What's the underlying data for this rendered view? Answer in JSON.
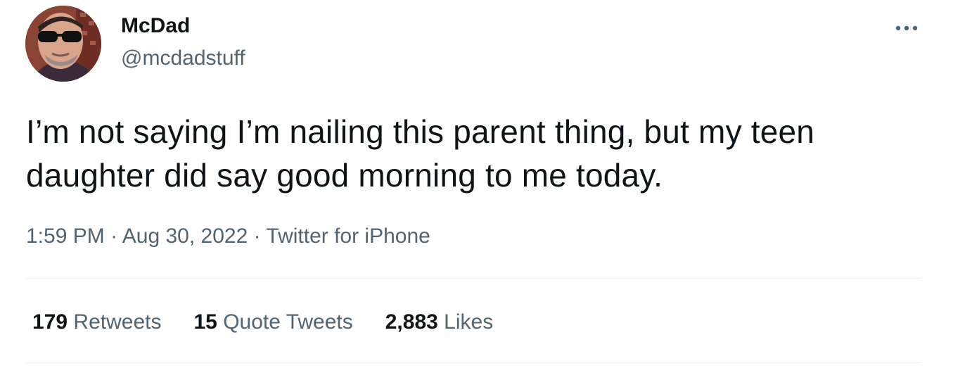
{
  "author": {
    "display_name": "McDad",
    "handle": "@mcdadstuff"
  },
  "tweet": {
    "text": "I’m not saying I’m nailing this parent thing, but my teen daughter did say good morning to me today.",
    "time": "1:59 PM",
    "date": "Aug 30, 2022",
    "source": "Twitter for iPhone",
    "separator": "·"
  },
  "stats": {
    "retweets_count": "179",
    "retweets_label": "Retweets",
    "quotes_count": "15",
    "quotes_label": "Quote Tweets",
    "likes_count": "2,883",
    "likes_label": "Likes"
  },
  "icons": {
    "more": "more-horizontal-icon",
    "avatar": "profile-photo"
  },
  "colors": {
    "primary_text": "#0f1419",
    "secondary_text": "#536471",
    "divider": "#eff3f4"
  }
}
